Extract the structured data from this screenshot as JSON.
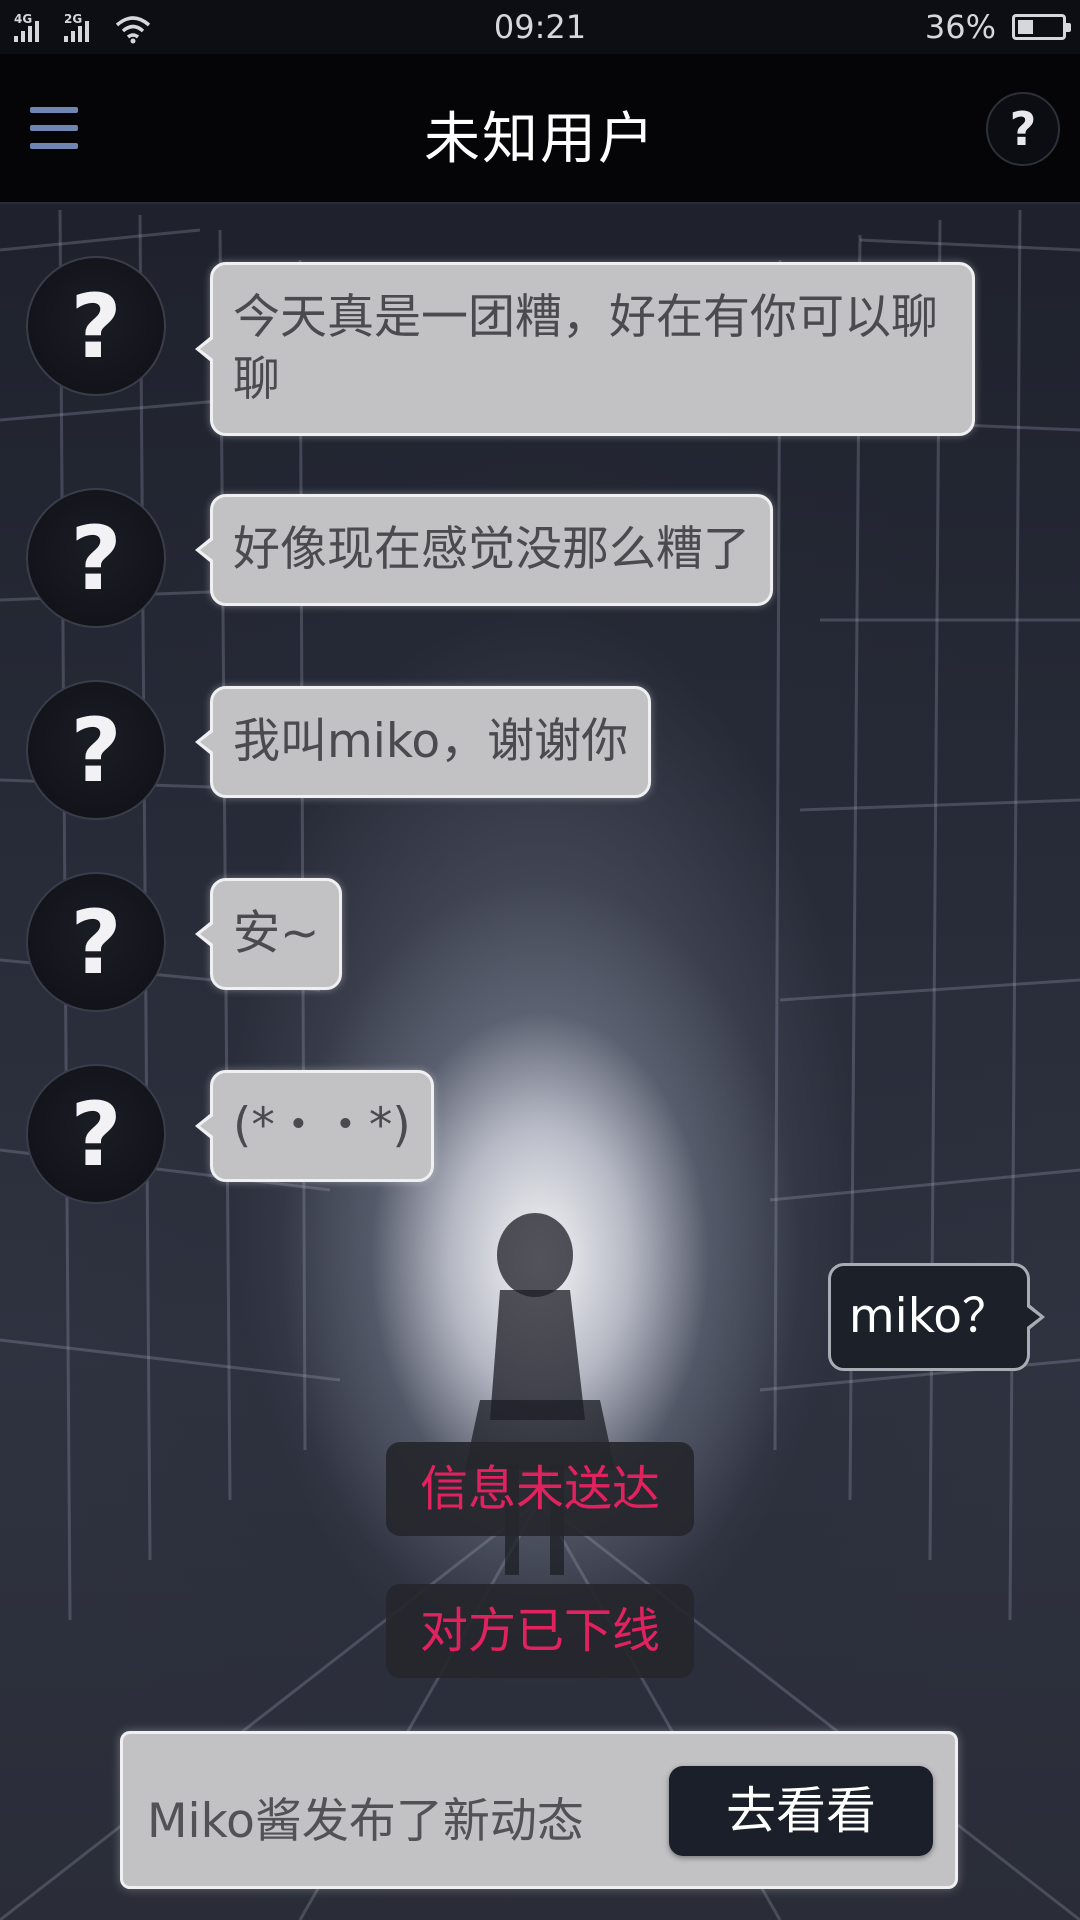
{
  "status_bar": {
    "network_1": "4G",
    "network_2": "2G",
    "time": "09:21",
    "battery_percent": "36%",
    "battery_level": 0.36,
    "icons": [
      "signal-icon",
      "signal-icon",
      "wifi-icon",
      "battery-icon"
    ]
  },
  "header": {
    "title": "未知用户",
    "menu_icon": "hamburger-menu-icon",
    "help_label": "?"
  },
  "chat": {
    "avatar_label": "?",
    "incoming": [
      {
        "text": "今天真是一团糟，好在有你可以聊聊"
      },
      {
        "text": "好像现在感觉没那么糟了"
      },
      {
        "text": "我叫miko，谢谢你"
      },
      {
        "text": "安~"
      },
      {
        "text": "(*・・*)"
      }
    ],
    "outgoing": [
      {
        "text": "miko？"
      }
    ],
    "status_notices": [
      "信息未送达",
      "对方已下线"
    ]
  },
  "banner": {
    "text": "Miko酱发布了新动态",
    "button_label": "去看看"
  },
  "colors": {
    "notice_text": "#e2225e",
    "bubble_incoming": "#c2c2c4",
    "bubble_outgoing": "#1c2029",
    "menu_icon": "#6f86b3"
  }
}
